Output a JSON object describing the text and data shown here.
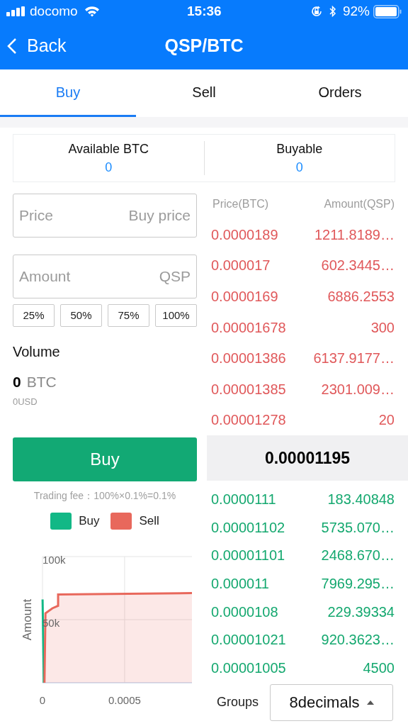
{
  "status_bar": {
    "carrier": "docomo",
    "time": "15:36",
    "battery": "92%"
  },
  "nav": {
    "back": "Back",
    "title": "QSP/BTC"
  },
  "tabs": [
    {
      "label": "Buy",
      "selected": true
    },
    {
      "label": "Sell",
      "selected": false
    },
    {
      "label": "Orders",
      "selected": false
    }
  ],
  "balances": [
    {
      "label": "Available BTC",
      "value": "0"
    },
    {
      "label": "Buyable",
      "value": "0"
    }
  ],
  "price_field": {
    "placeholder": "Price",
    "unit": "Buy price"
  },
  "amount_field": {
    "placeholder": "Amount",
    "unit": "QSP"
  },
  "percent_buttons": [
    "25%",
    "50%",
    "75%",
    "100%"
  ],
  "volume": {
    "label": "Volume",
    "value": "0",
    "unit": "BTC",
    "usd": "0USD"
  },
  "buy_button": "Buy",
  "trading_fee": "Trading fee：100%×0.1%=0.1%",
  "order_book": {
    "columns": [
      "Price(BTC)",
      "Amount(QSP)"
    ],
    "asks": [
      {
        "price": "0.0000189",
        "amount": "1211.8189…"
      },
      {
        "price": "0.000017",
        "amount": "602.3445…"
      },
      {
        "price": "0.0000169",
        "amount": "6886.2553"
      },
      {
        "price": "0.00001678",
        "amount": "300"
      },
      {
        "price": "0.00001386",
        "amount": "6137.9177…"
      },
      {
        "price": "0.00001385",
        "amount": "2301.009…"
      },
      {
        "price": "0.00001278",
        "amount": "20"
      }
    ],
    "last_price": "0.00001195",
    "bids": [
      {
        "price": "0.0000111",
        "amount": "183.40848"
      },
      {
        "price": "0.00001102",
        "amount": "5735.070…"
      },
      {
        "price": "0.00001101",
        "amount": "2468.670…"
      },
      {
        "price": "0.000011",
        "amount": "7969.295…"
      },
      {
        "price": "0.0000108",
        "amount": "229.39334"
      },
      {
        "price": "0.00001021",
        "amount": "920.3623…"
      },
      {
        "price": "0.00001005",
        "amount": "4500"
      }
    ]
  },
  "groups": {
    "label": "Groups",
    "value": "8decimals"
  },
  "depth_chart": {
    "chart_data": {
      "type": "area",
      "ylabel": "Amount",
      "xlim": [
        0,
        0.00091
      ],
      "ylim": [
        0,
        100000
      ],
      "xticks": [
        0,
        0.0005
      ],
      "yticks": [
        {
          "value": 50000,
          "label": "50k"
        },
        {
          "value": 100000,
          "label": "100k"
        }
      ],
      "series": [
        {
          "name": "Buy",
          "color": "#12b886",
          "x": [
            5e-07,
            8e-06
          ],
          "values": [
            66000,
            0
          ]
        },
        {
          "name": "Sell",
          "color": "#e8685c",
          "x": [
            1.2e-05,
            1.8e-05,
            6e-05,
            9.5e-05,
            9.5e-05,
            0.00091
          ],
          "values": [
            0,
            55000,
            59000,
            61000,
            70000,
            71000
          ]
        }
      ]
    }
  }
}
